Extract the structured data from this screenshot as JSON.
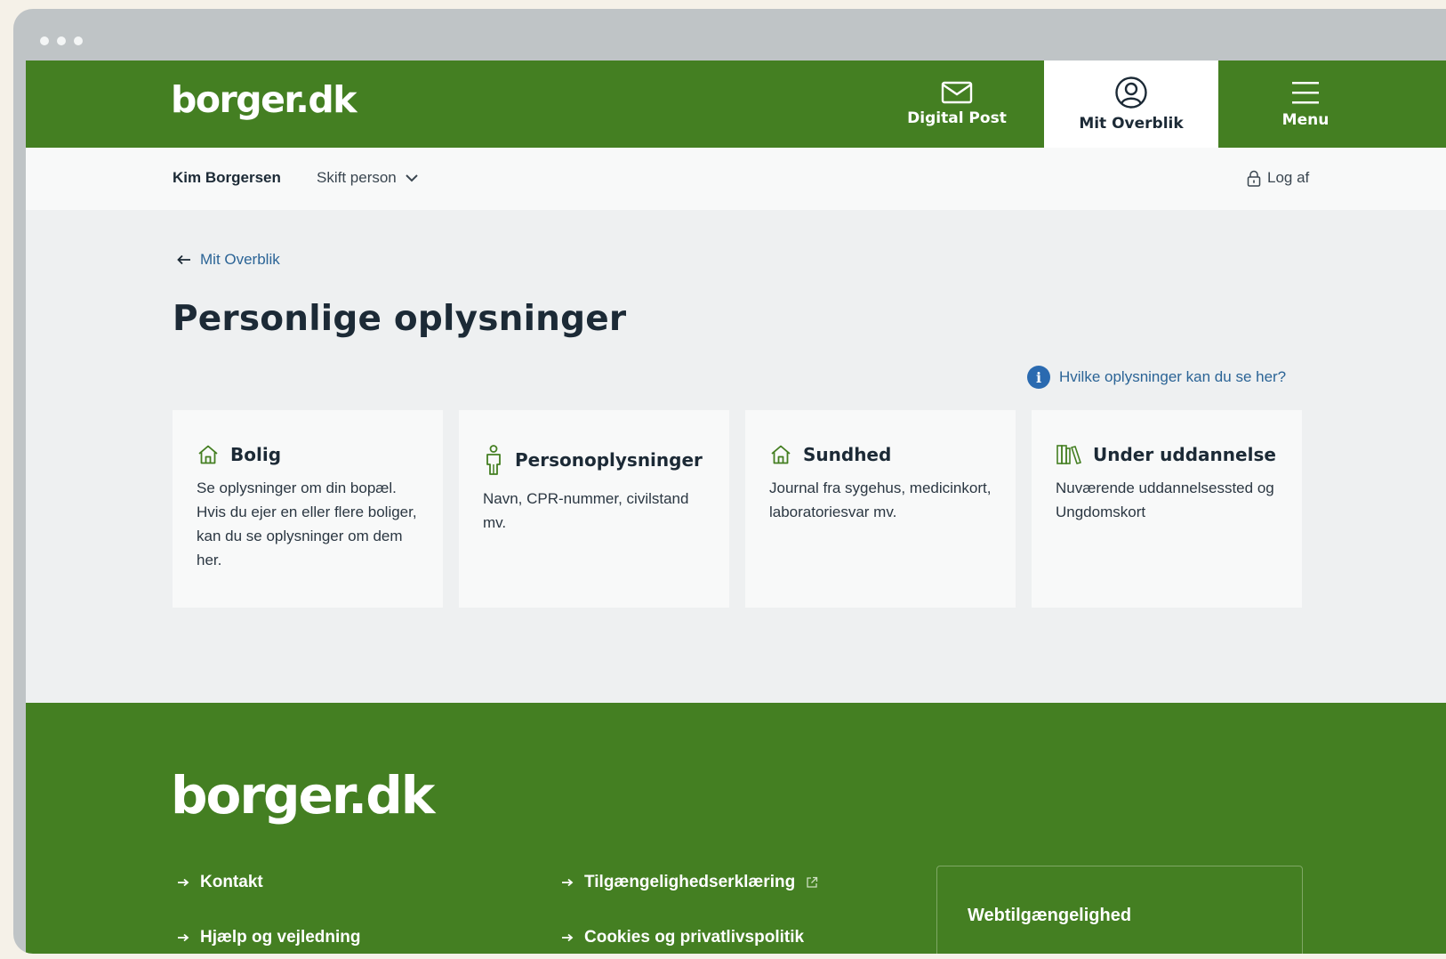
{
  "browser": {
    "dots": 3
  },
  "header": {
    "logo": "borger.dk",
    "nav": {
      "digital_post": "Digital Post",
      "mit_overblik": "Mit Overblik",
      "menu": "Menu"
    }
  },
  "userbar": {
    "name": "Kim Borgersen",
    "switch_person": "Skift person",
    "logout": "Log af"
  },
  "main": {
    "back_link": "Mit Overblik",
    "title": "Personlige oplysninger",
    "info_link": "Hvilke oplysninger kan du se her?",
    "cards": [
      {
        "icon": "house-icon",
        "title": "Bolig",
        "description": "Se oplysninger om din bopæl. Hvis du ejer en eller flere boliger, kan du se oplysninger om dem her."
      },
      {
        "icon": "person-icon",
        "title": "Personoplysninger",
        "description": "Navn, CPR-nummer, civilstand mv."
      },
      {
        "icon": "house-icon",
        "title": "Sundhed",
        "description": "Journal fra sygehus, medicinkort, laboratoriesvar mv."
      },
      {
        "icon": "books-icon",
        "title": "Under uddannelse",
        "description": "Nuværende uddannelsessted og Ungdomskort"
      }
    ]
  },
  "footer": {
    "logo": "borger.dk",
    "links": {
      "kontakt": "Kontakt",
      "hjaelp": "Hjælp og vejledning",
      "tilgaengelighed": "Tilgængelighedserklæring",
      "cookies": "Cookies og privatlivspolitik"
    },
    "webtil_title": "Webtilgængelighed"
  },
  "colors": {
    "brand_green": "#447f22",
    "link_blue": "#2b6496",
    "text_dark": "#1c2a36",
    "page_bg": "#eef0f1"
  }
}
